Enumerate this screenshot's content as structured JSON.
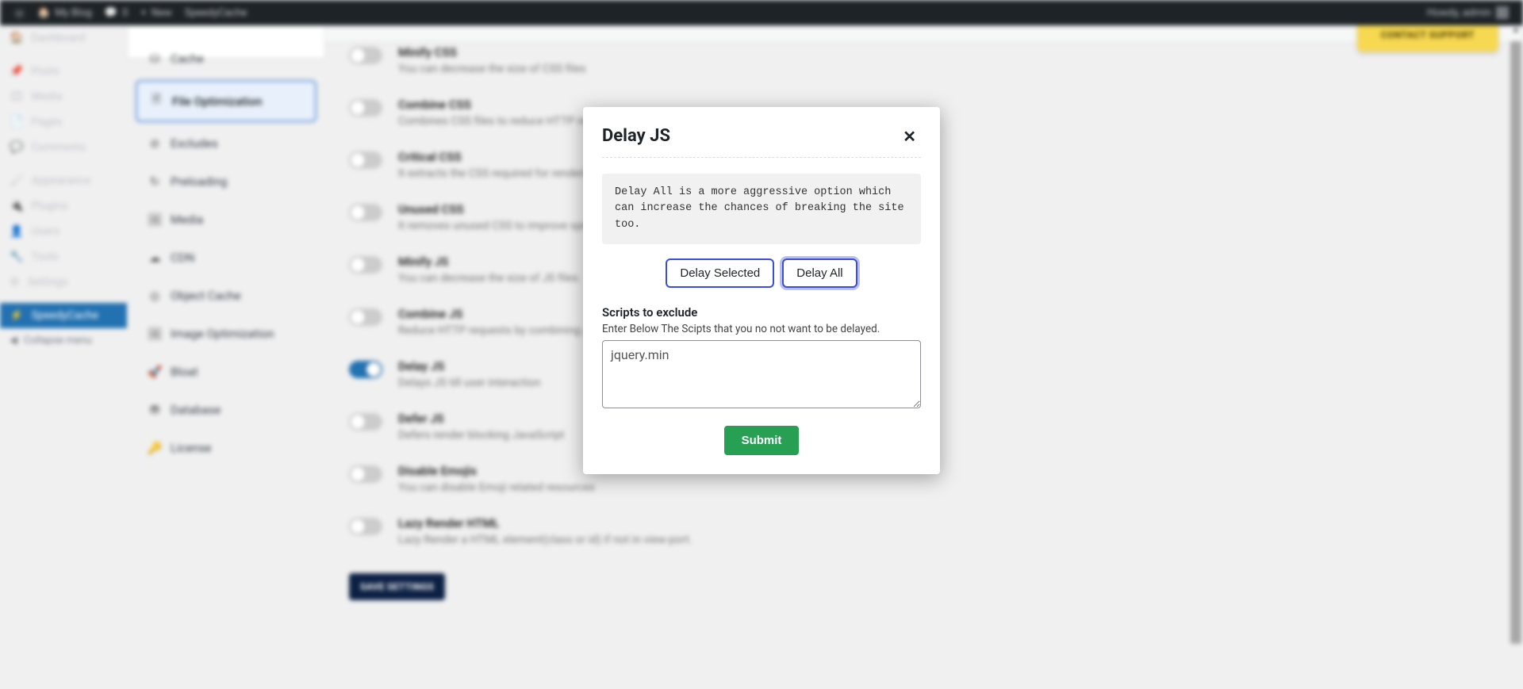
{
  "adminbar": {
    "site": "My Blog",
    "comments": "0",
    "new": "New",
    "plugin": "SpeedyCache",
    "howdy": "Howdy, admin"
  },
  "wpmenu": {
    "items": [
      {
        "icon": "🏠",
        "label": "Dashboard"
      },
      {
        "icon": "📌",
        "label": "Posts"
      },
      {
        "icon": "🎞",
        "label": "Media"
      },
      {
        "icon": "📄",
        "label": "Pages"
      },
      {
        "icon": "💬",
        "label": "Comments"
      },
      {
        "icon": "🖌",
        "label": "Appearance"
      },
      {
        "icon": "🔌",
        "label": "Plugins"
      },
      {
        "icon": "👤",
        "label": "Users"
      },
      {
        "icon": "🔧",
        "label": "Tools"
      },
      {
        "icon": "⚙",
        "label": "Settings"
      },
      {
        "icon": "⚡",
        "label": "SpeedyCache",
        "active": true
      }
    ],
    "collapse": "Collapse menu"
  },
  "tabs": [
    {
      "icon": "⛁",
      "label": "Cache"
    },
    {
      "icon": "🗎",
      "label": "File Optimization",
      "active": true
    },
    {
      "icon": "⊘",
      "label": "Excludes"
    },
    {
      "icon": "↻",
      "label": "Preloading"
    },
    {
      "icon": "🖼",
      "label": "Media"
    },
    {
      "icon": "☁",
      "label": "CDN"
    },
    {
      "icon": "◎",
      "label": "Object Cache"
    },
    {
      "icon": "🖼",
      "label": "Image Optimization"
    },
    {
      "icon": "🚀",
      "label": "Bloat"
    },
    {
      "icon": "⛃",
      "label": "Database"
    },
    {
      "icon": "🔑",
      "label": "License"
    }
  ],
  "rows": [
    {
      "on": false,
      "title": "Minify CSS",
      "desc": "You can decrease the size of CSS files"
    },
    {
      "on": false,
      "title": "Combine CSS",
      "desc": "Combines CSS files to reduce HTTP requests"
    },
    {
      "on": false,
      "title": "Critical CSS",
      "desc": "It extracts the CSS required for rendering above the fold"
    },
    {
      "on": false,
      "title": "Unused CSS",
      "desc": "It removes unused CSS to improve speed"
    },
    {
      "on": false,
      "title": "Minify JS",
      "desc": "You can decrease the size of JS files"
    },
    {
      "on": false,
      "title": "Combine JS",
      "desc": "Reduce HTTP requests by combining JS files"
    },
    {
      "on": true,
      "title": "Delay JS",
      "desc": "Delays JS till user interaction"
    },
    {
      "on": false,
      "title": "Defer JS",
      "desc": "Defers render blocking JavaScript"
    },
    {
      "on": false,
      "title": "Disable Emojis",
      "desc": "You can disable Emoji related resources"
    },
    {
      "on": false,
      "title": "Lazy Render HTML",
      "desc": "Lazy Render a HTML element(class or id) if not in view-port."
    }
  ],
  "support": "CONTACT SUPPORT",
  "save": "SAVE SETTINGS",
  "modal": {
    "title": "Delay JS",
    "note": "Delay All is a more aggressive option which can increase the chances of breaking the site too.",
    "btn_selected": "Delay Selected",
    "btn_all": "Delay All",
    "exclude_label": "Scripts to exclude",
    "exclude_hint": "Enter Below The Scipts that you no not want to be delayed.",
    "exclude_value": "jquery.min",
    "submit": "Submit"
  }
}
